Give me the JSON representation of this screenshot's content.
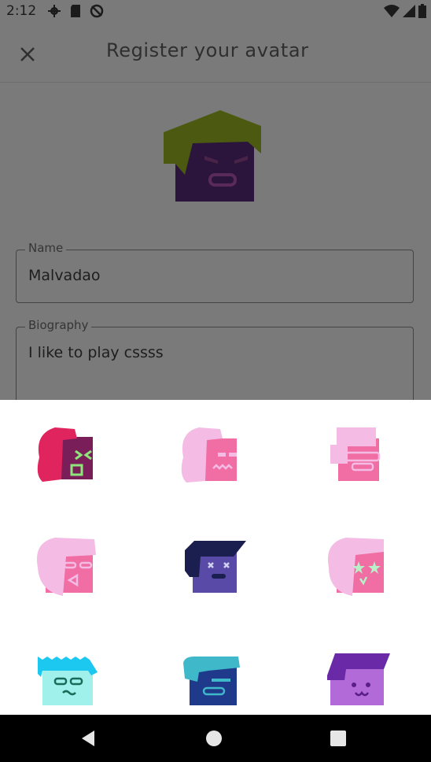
{
  "status": {
    "time": "2:12",
    "icons": [
      "gear-icon",
      "sd-card-icon",
      "no-sync-icon",
      "wifi-icon",
      "signal-icon",
      "battery-icon"
    ]
  },
  "header": {
    "title": "Register your avatar",
    "close_icon": "close-icon"
  },
  "form": {
    "name_label": "Name",
    "name_value": "Malvadao",
    "bio_label": "Biography",
    "bio_value": "I like to play cssss"
  },
  "avatar_picker": {
    "items": [
      "avatar-1",
      "avatar-2",
      "avatar-3",
      "avatar-4",
      "avatar-5",
      "avatar-6",
      "avatar-7",
      "avatar-8",
      "avatar-9"
    ]
  },
  "navigation": {
    "buttons": [
      "back-icon",
      "home-icon",
      "recents-icon"
    ]
  },
  "colors": {
    "scrim": "#7a7a7a",
    "sheet": "#ffffff",
    "nav": "#000000"
  }
}
